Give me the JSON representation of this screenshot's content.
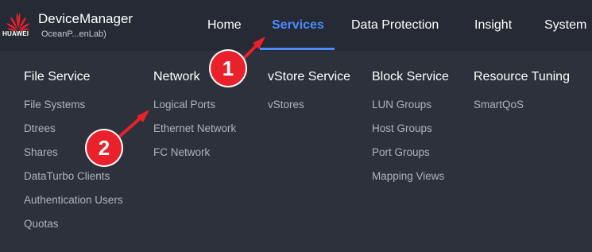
{
  "brand": {
    "logo_text": "HUAWEI",
    "title": "DeviceManager",
    "subtitle": "OceanP...enLab)"
  },
  "nav": [
    {
      "label": "Home",
      "active": false
    },
    {
      "label": "Services",
      "active": true
    },
    {
      "label": "Data Protection",
      "active": false
    },
    {
      "label": "Insight",
      "active": false
    },
    {
      "label": "System",
      "active": false
    }
  ],
  "menu": {
    "columns": [
      {
        "heading": "File Service",
        "items": [
          "File Systems",
          "Dtrees",
          "Shares",
          "DataTurbo Clients",
          "Authentication Users",
          "Quotas"
        ]
      },
      {
        "heading": "Network",
        "items": [
          "Logical Ports",
          "Ethernet Network",
          "FC Network"
        ]
      },
      {
        "heading": "vStore Service",
        "items": [
          "vStores"
        ]
      },
      {
        "heading": "Block Service",
        "items": [
          "LUN Groups",
          "Host Groups",
          "Port Groups",
          "Mapping Views"
        ]
      },
      {
        "heading": "Resource Tuning",
        "items": [
          "SmartQoS"
        ]
      }
    ]
  },
  "annotations": {
    "step1": "1",
    "step2": "2"
  },
  "colors": {
    "accent": "#4a8bff",
    "badge": "#e8212b",
    "logo": "#e8212b"
  }
}
